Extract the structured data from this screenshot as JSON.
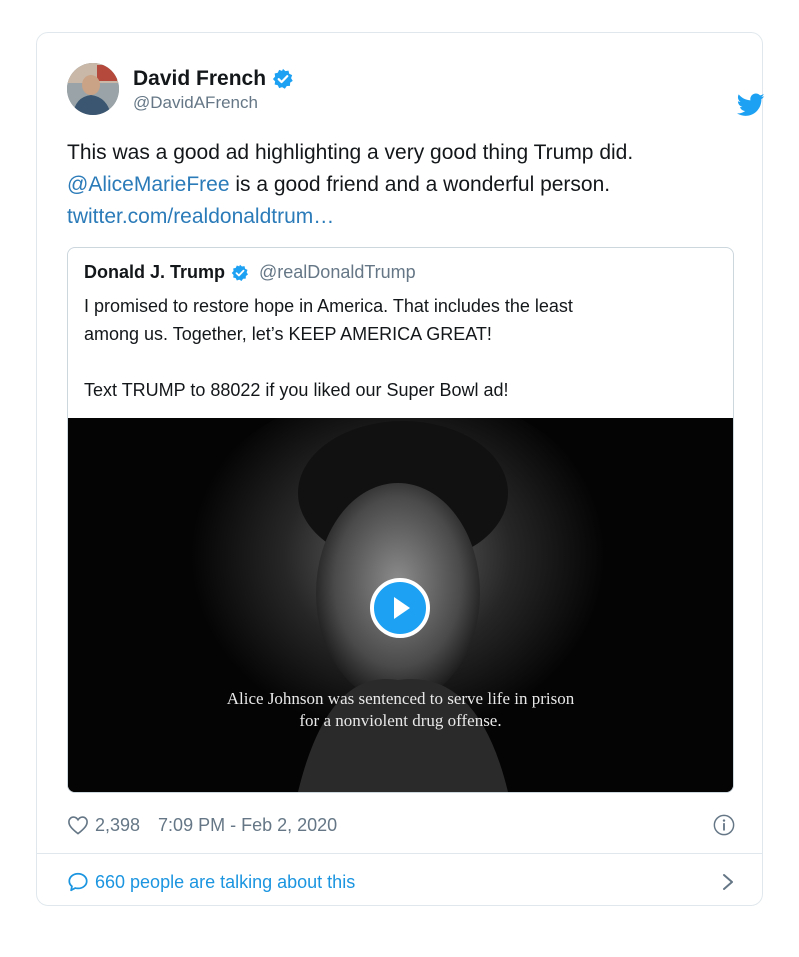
{
  "tweet": {
    "author_name": "David French",
    "author_handle": "@DavidAFrench",
    "text_part1": "This was a good ad highlighting a very good thing Trump did. ",
    "mention": "@AliceMarieFree",
    "text_part2": " is a good friend and a wonderful person.",
    "link": "twitter.com/realdonaldtrum…",
    "likes": "2,398",
    "timestamp": "7:09 PM - Feb 2, 2020",
    "talking": "660 people are talking about this"
  },
  "quoted": {
    "author_name": "Donald J. Trump",
    "author_handle": "@realDonaldTrump",
    "lines": [
      "I promised to restore hope in America. That includes the least",
      "among us. Together, let’s KEEP AMERICA GREAT!",
      "",
      "Text TRUMP to 88022 if you liked our Super Bowl ad!"
    ],
    "video_caption": [
      "Alice Johnson was sentenced to serve life in prison",
      "for a nonviolent drug offense."
    ]
  },
  "icons": {
    "verified": "verified-badge-icon",
    "brand": "twitter-bird-icon",
    "like": "heart-icon",
    "info": "info-icon",
    "talk": "speech-bubble-icon",
    "chevron": "chevron-right-icon",
    "play": "play-icon"
  },
  "colors": {
    "twitter_blue": "#1da1f2",
    "link": "#2b7bb9",
    "secondary_text": "#657786",
    "border": "#e1e8ed"
  }
}
